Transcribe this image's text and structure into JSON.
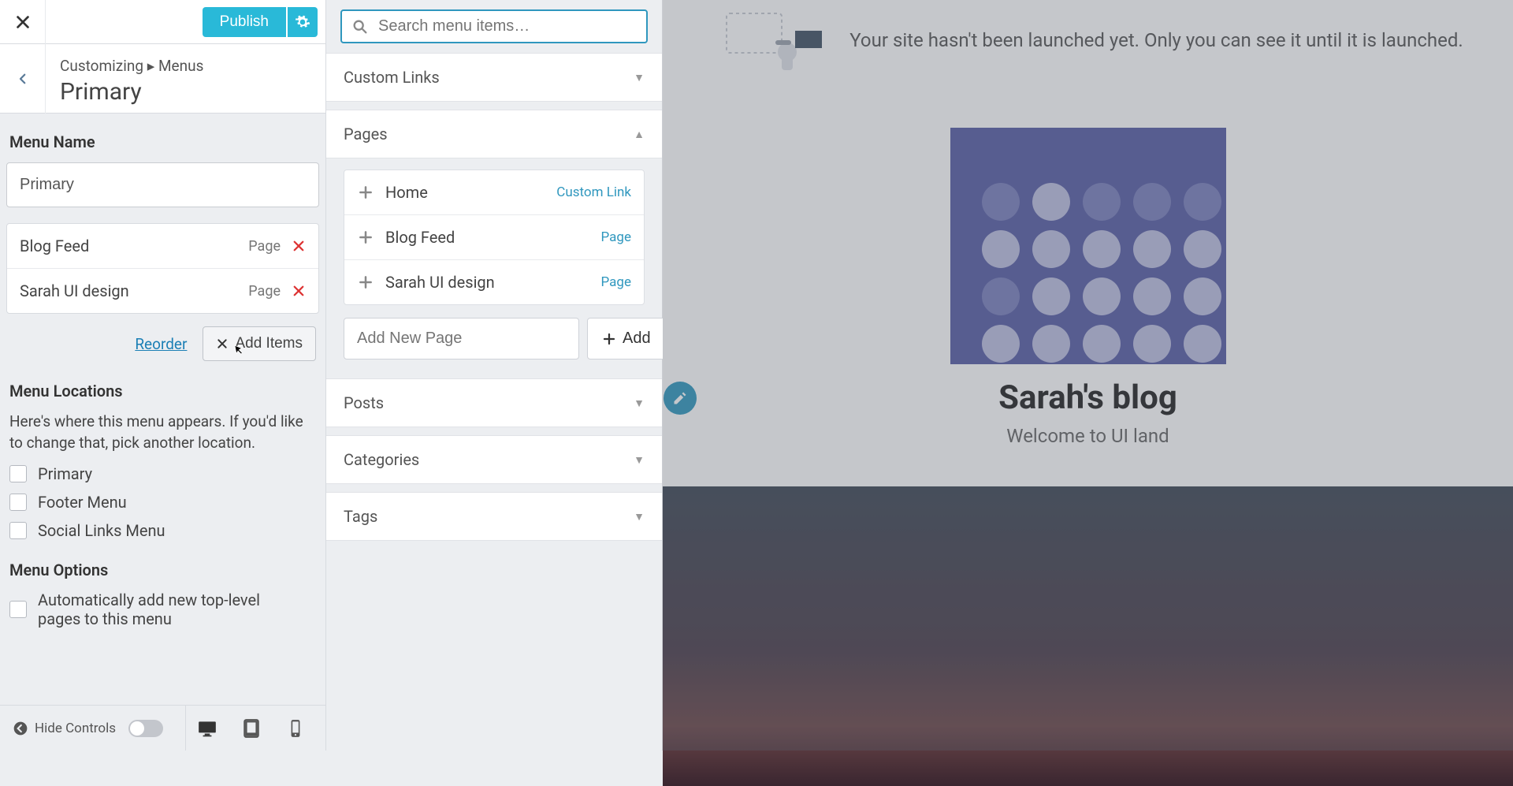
{
  "topbar": {
    "publish_label": "Publish"
  },
  "breadcrumb": {
    "path": "Customizing ▸ Menus",
    "title": "Primary"
  },
  "menu_name": {
    "label": "Menu Name",
    "value": "Primary"
  },
  "menu_items": [
    {
      "name": "Blog Feed",
      "type": "Page"
    },
    {
      "name": "Sarah UI design",
      "type": "Page"
    }
  ],
  "actions": {
    "reorder": "Reorder",
    "add_items": "Add Items"
  },
  "locations": {
    "heading": "Menu Locations",
    "desc": "Here's where this menu appears. If you'd like to change that, pick another location.",
    "options": [
      "Primary",
      "Footer Menu",
      "Social Links Menu"
    ]
  },
  "menu_options": {
    "heading": "Menu Options",
    "auto_add": "Automatically add new top-level pages to this menu"
  },
  "footer": {
    "hide_controls": "Hide Controls"
  },
  "add_panel": {
    "search_placeholder": "Search menu items…",
    "sections": {
      "custom_links": "Custom Links",
      "pages": "Pages",
      "posts": "Posts",
      "categories": "Categories",
      "tags": "Tags"
    },
    "pages": [
      {
        "name": "Home",
        "type": "Custom Link"
      },
      {
        "name": "Blog Feed",
        "type": "Page"
      },
      {
        "name": "Sarah UI design",
        "type": "Page"
      }
    ],
    "add_new_placeholder": "Add New Page",
    "add_btn": "Add"
  },
  "preview": {
    "notice": "Your site hasn't been launched yet. Only you can see it until it is launched.",
    "blog_title": "Sarah's blog",
    "blog_tagline": "Welcome to UI land"
  }
}
